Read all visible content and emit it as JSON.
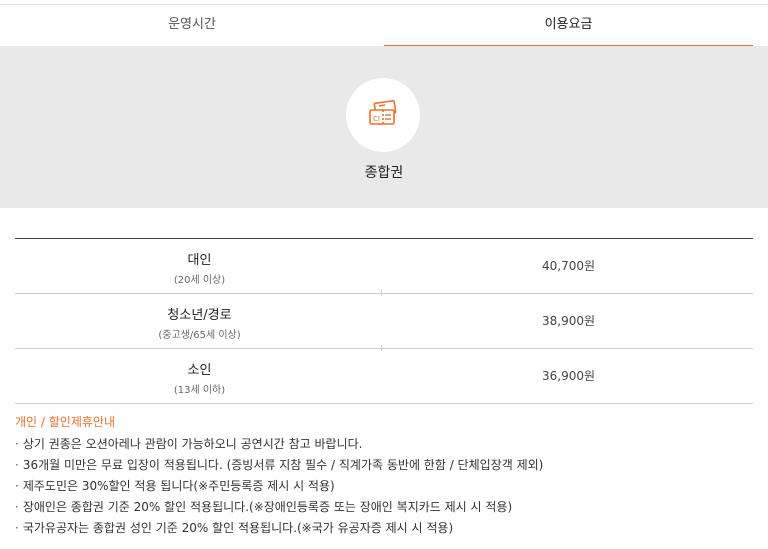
{
  "tabs": [
    {
      "label": "운영시간",
      "active": false
    },
    {
      "label": "이용요금",
      "active": true
    }
  ],
  "hero": {
    "icon": "ticket-icon",
    "title": "종합권"
  },
  "prices": [
    {
      "label": "대인",
      "sub": "(20세 이상)",
      "price": "40,700원"
    },
    {
      "label": "청소년/경로",
      "sub": "(중고생/65세 이상)",
      "price": "38,900원"
    },
    {
      "label": "소인",
      "sub": "(13세 이하)",
      "price": "36,900원"
    }
  ],
  "notice": {
    "title": "개인 / 할인제휴안내",
    "bullet": "·",
    "items": [
      "상기 권종은 오션아레나 관람이 가능하오니 공연시간 참고 바랍니다.",
      "36개월 미만은 무료 입장이 적용됩니다. (증빙서류 지참 필수 / 직계가족 동반에 한함 / 단체입장객 제외)",
      "제주도민은 30%할인 적용 됩니다(※주민등록증 제시 시 적용)",
      "장애인은 종합권 기준 20% 할인 적용됩니다.(※장애인등록증 또는 장애인 복지카드 제시 시 적용)",
      "국가유공자는 종합권 성인 기준 20% 할인 적용됩니다.(※국가 유공자증 제시 시 적용)"
    ]
  },
  "colors": {
    "accent": "#e8702a",
    "hero_bg": "#e9e9e9"
  }
}
